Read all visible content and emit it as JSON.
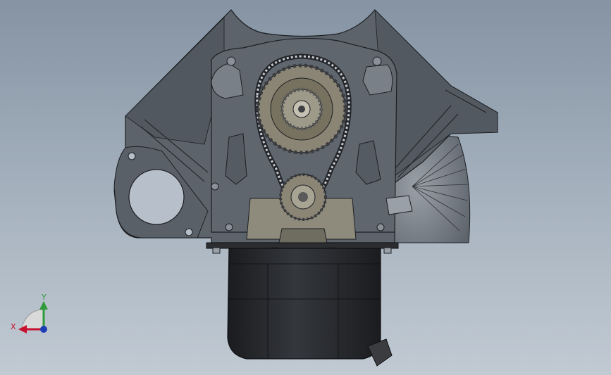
{
  "colors": {
    "background_top": "#8593a3",
    "background_bottom": "#c1cad3",
    "block": "#5d636b",
    "block_dark": "#3e434a",
    "edge": "#1c1f23",
    "gear": "#8a8574",
    "oil_pan": "#2a2c30",
    "axis_x": "#c8102e",
    "axis_y": "#2e9a3a",
    "axis_z": "#1d3fb5"
  },
  "triad": {
    "x_label": "X",
    "y_label": "Y"
  }
}
